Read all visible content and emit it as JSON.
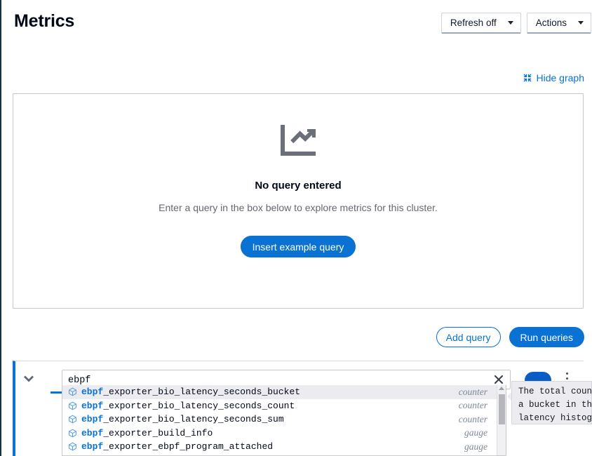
{
  "page": {
    "title": "Metrics"
  },
  "header": {
    "refresh": {
      "label": "Refresh off",
      "icon": "chevron-down-icon"
    },
    "actions": {
      "label": "Actions",
      "icon": "chevron-down-icon"
    }
  },
  "graph": {
    "hide_graph_label": "Hide graph",
    "hide_graph_icon": "collapse-icon",
    "empty_state": {
      "icon": "line-chart-icon",
      "title": "No query entered",
      "description": "Enter a query in the box below to explore metrics for this cluster.",
      "button_label": "Insert example query"
    }
  },
  "query_actions": {
    "add_query_label": "Add query",
    "run_queries_label": "Run queries"
  },
  "query_editor": {
    "expand_icon": "chevron-down-icon",
    "input_value": "ebpf",
    "input_placeholder": "",
    "clear_icon": "close-icon",
    "more_icon": "kebab-menu-icon",
    "suggestions": [
      {
        "prefix": "ebpf",
        "rest": "_exporter_bio_latency_seconds_bucket",
        "type": "counter",
        "icon": "cube-icon",
        "selected": true
      },
      {
        "prefix": "ebpf",
        "rest": "_exporter_bio_latency_seconds_count",
        "type": "counter",
        "icon": "cube-icon",
        "selected": false
      },
      {
        "prefix": "ebpf",
        "rest": "_exporter_bio_latency_seconds_sum",
        "type": "counter",
        "icon": "cube-icon",
        "selected": false
      },
      {
        "prefix": "ebpf",
        "rest": "_exporter_build_info",
        "type": "gauge",
        "icon": "cube-icon",
        "selected": false
      },
      {
        "prefix": "ebpf",
        "rest": "_exporter_ebpf_program_attached",
        "type": "gauge",
        "icon": "cube-icon",
        "selected": false
      }
    ]
  },
  "tooltip": {
    "line1": "The total coun",
    "line2": "a bucket in th",
    "line3": "latency histog"
  },
  "colors": {
    "accent_blue": "#0972d3",
    "text_primary": "#000716",
    "text_secondary": "#656871",
    "border_gray": "#c6c6cd",
    "selected_row": "#ebebf0",
    "rail_navy": "#16324f"
  }
}
